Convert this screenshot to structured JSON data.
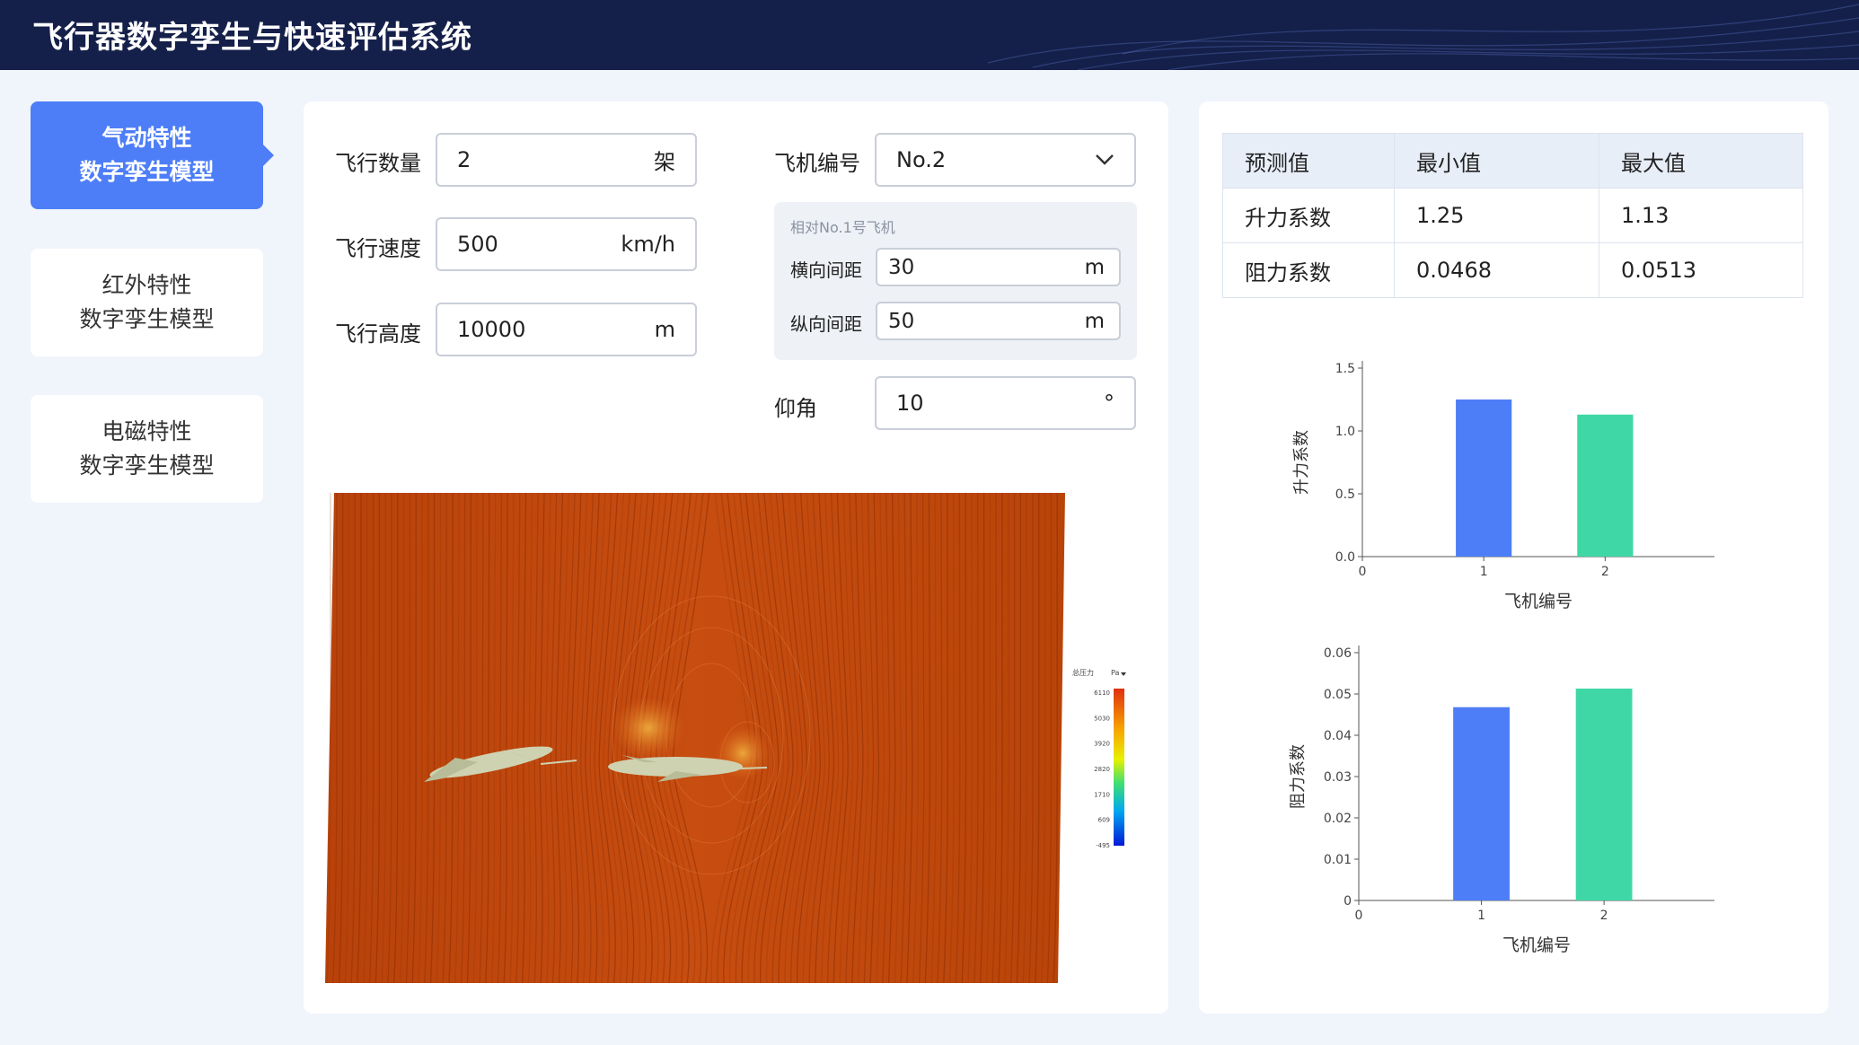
{
  "app": {
    "title": "飞行器数字孪生与快速评估系统"
  },
  "sidebar": {
    "items": [
      {
        "line1": "气动特性",
        "line2": "数字孪生模型",
        "active": true
      },
      {
        "line1": "红外特性",
        "line2": "数字孪生模型",
        "active": false
      },
      {
        "line1": "电磁特性",
        "line2": "数字孪生模型",
        "active": false
      }
    ]
  },
  "form": {
    "count": {
      "label": "飞行数量",
      "value": "2",
      "unit": "架"
    },
    "speed": {
      "label": "飞行速度",
      "value": "500",
      "unit": "km/h"
    },
    "altitude": {
      "label": "飞行高度",
      "value": "10000",
      "unit": "m"
    },
    "aircraft": {
      "label": "飞机编号",
      "value": "No.2"
    },
    "relative": {
      "title": "相对No.1号飞机",
      "lateral": {
        "label": "横向间距",
        "value": "30",
        "unit": "m"
      },
      "longitudinal": {
        "label": "纵向间距",
        "value": "50",
        "unit": "m"
      }
    },
    "pitch": {
      "label": "仰角",
      "value": "10",
      "unit": "°"
    }
  },
  "colorbar": {
    "title": "总压力",
    "unit": "Pa",
    "ticks": [
      "6110",
      "5030",
      "3920",
      "2820",
      "1710",
      "609",
      "-495"
    ]
  },
  "results": {
    "headers": [
      "预测值",
      "最小值",
      "最大值"
    ],
    "rows": [
      [
        "升力系数",
        "1.25",
        "1.13"
      ],
      [
        "阻力系数",
        "0.0468",
        "0.0513"
      ]
    ]
  },
  "colors": {
    "series1": "#4d7ef7",
    "series2": "#3ed7a5",
    "accent": "#4d7ef7",
    "header_bg": "#15204a"
  },
  "chart_data": [
    {
      "type": "bar",
      "categories": [
        "1",
        "2"
      ],
      "values": [
        1.25,
        1.13
      ],
      "xlabel": "飞机编号",
      "ylabel": "升力系数",
      "xlim": [
        0,
        2.9
      ],
      "ylim": [
        0,
        1.5
      ],
      "yticks": [
        "0.0",
        "0.5",
        "1.0",
        "1.5"
      ],
      "xticks": [
        "0",
        "1",
        "2"
      ],
      "grid": false
    },
    {
      "type": "bar",
      "categories": [
        "1",
        "2"
      ],
      "values": [
        0.0468,
        0.0513
      ],
      "xlabel": "飞机编号",
      "ylabel": "阻力系数",
      "xlim": [
        0,
        2.9
      ],
      "ylim": [
        0,
        0.06
      ],
      "yticks": [
        "0",
        "0.01",
        "0.02",
        "0.03",
        "0.04",
        "0.05",
        "0.06"
      ],
      "xticks": [
        "0",
        "1",
        "2"
      ],
      "grid": false
    }
  ]
}
